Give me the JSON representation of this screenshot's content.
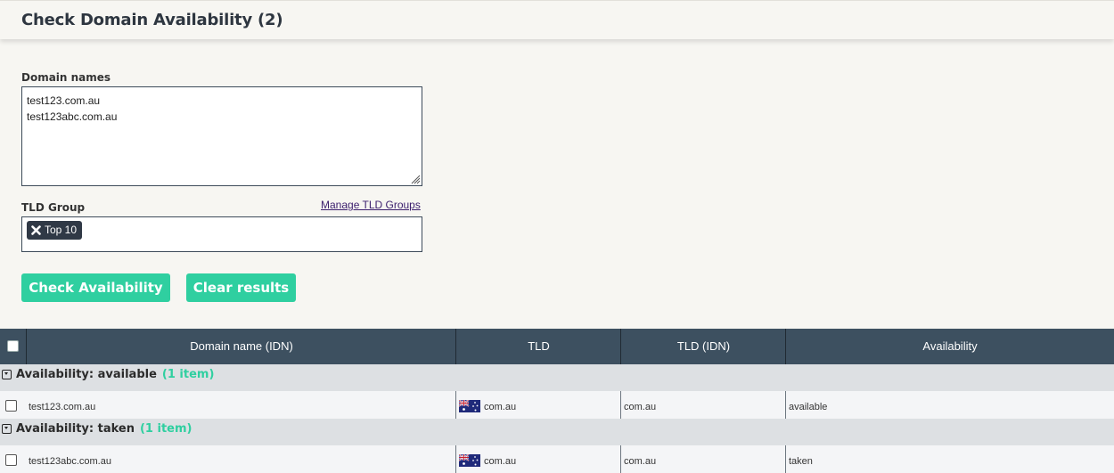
{
  "header": {
    "title": "Check Domain Availability",
    "count": "(2)"
  },
  "form": {
    "domains_label": "Domain names",
    "domains": [
      "test123.com.au",
      "test123abc.com.au"
    ],
    "tld_label": "TLD Group",
    "manage_link": "Manage TLD Groups",
    "tld_tag": "Top 10",
    "check_button": "Check Availability",
    "clear_button": "Clear results"
  },
  "grid": {
    "columns": [
      "Domain name (IDN)",
      "TLD",
      "TLD (IDN)",
      "Availability"
    ],
    "groups": [
      {
        "label": "Availability:",
        "value": "available",
        "count": "(1 item)",
        "row": {
          "domain": "test123.com.au",
          "tld": "com.au",
          "tld_idn": "com.au",
          "availability": "available"
        }
      },
      {
        "label": "Availability:",
        "value": "taken",
        "count": "(1 item)",
        "row": {
          "domain": "test123abc.com.au",
          "tld": "com.au",
          "tld_idn": "com.au",
          "availability": "taken"
        }
      }
    ]
  },
  "colors": {
    "accent": "#2fcfa0",
    "header_bg": "#3d5060",
    "dark": "#303946"
  },
  "icons": {
    "tag_remove": "close-icon",
    "group_toggle": "collapse-icon",
    "flag": "australia-flag-icon"
  }
}
